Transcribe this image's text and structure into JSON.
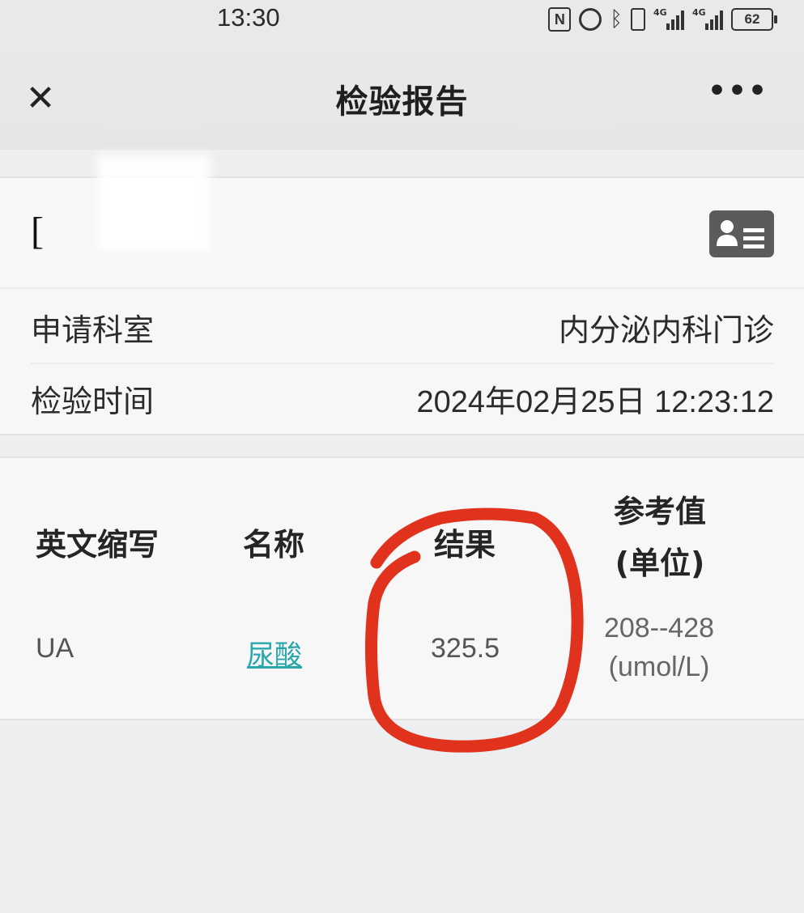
{
  "status_bar": {
    "time": "13:30",
    "icons": [
      "nfc-icon",
      "alarm-icon",
      "bluetooth-icon",
      "vibrate-icon",
      "signal-4g-icon",
      "signal-4g-icon",
      "battery-icon"
    ],
    "network_label_1": "4G",
    "network_label_2": "4G",
    "battery": "62"
  },
  "nav": {
    "title": "检验报告",
    "close_glyph": "✕",
    "more_glyph": "•••"
  },
  "patient": {
    "name_partial": "[",
    "icon": "id-card-icon"
  },
  "info": {
    "dept_label": "申请科室",
    "dept_value": "内分泌内科门诊",
    "time_label": "检验时间",
    "time_value": "2024年02月25日 12:23:12"
  },
  "table": {
    "headers": {
      "abbr": "英文缩写",
      "name": "名称",
      "result": "结果",
      "ref_line1": "参考值",
      "ref_line2": "(单位)"
    },
    "rows": [
      {
        "abbr": "UA",
        "name": "尿酸",
        "result": "325.5",
        "ref_range": "208--428",
        "unit": "(umol/L)"
      }
    ]
  },
  "annotation_color": "#e0321c"
}
